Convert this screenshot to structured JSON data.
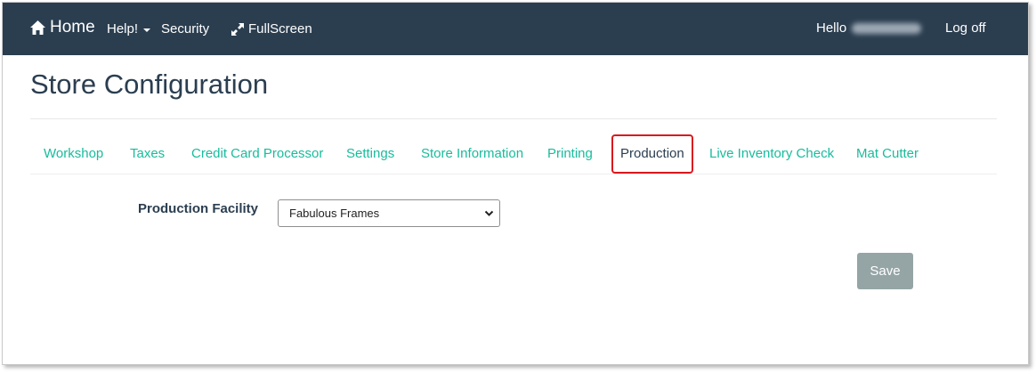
{
  "nav": {
    "home_label": "Home",
    "help_label": "Help!",
    "security_label": "Security",
    "fullscreen_label": "FullScreen",
    "hello_label": "Hello",
    "logoff_label": "Log off"
  },
  "page": {
    "title": "Store Configuration"
  },
  "tabs": [
    {
      "label": "Workshop"
    },
    {
      "label": "Taxes"
    },
    {
      "label": "Credit Card Processor"
    },
    {
      "label": "Settings"
    },
    {
      "label": "Store Information"
    },
    {
      "label": "Printing"
    },
    {
      "label": "Production",
      "active": true
    },
    {
      "label": "Live Inventory Check"
    },
    {
      "label": "Mat Cutter"
    }
  ],
  "form": {
    "facility_label": "Production Facility",
    "facility_value": "Fabulous Frames",
    "save_label": "Save"
  },
  "colors": {
    "navbar": "#2b3e50",
    "tab_link": "#18bc9c",
    "active_highlight": "#d9191f",
    "save_button": "#95a5a6"
  },
  "icons": {
    "home": "home-icon",
    "help_dropdown": "caret-down-icon",
    "fullscreen": "expand-arrows-icon",
    "select": "chevron-down-icon"
  }
}
